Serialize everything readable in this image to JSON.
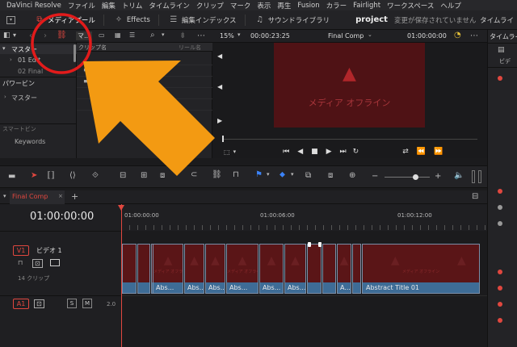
{
  "menubar": {
    "items": [
      "DaVinci Resolve",
      "ファイル",
      "編集",
      "トリム",
      "タイムライン",
      "クリップ",
      "マーク",
      "表示",
      "再生",
      "Fusion",
      "カラー",
      "Fairlight",
      "ワークスペース",
      "ヘルプ"
    ]
  },
  "toolbar": {
    "media_pool": "メディアプール",
    "effects": "Effects",
    "edit_index": "編集インデックス",
    "sound_library": "サウンドライブラリ",
    "project": "project",
    "unsaved": "変更が保存されていません",
    "timeline_label": "タイムライ"
  },
  "row2": {
    "master_btn": "マ...",
    "zoom": "15%",
    "timecode": "00:00:23:25",
    "timeline_name": "Final Comp",
    "timeline_tc": "01:00:00:00"
  },
  "sidebar": {
    "master": "マスター",
    "item1": "01 Edit",
    "item2": "02 Final",
    "powerbin": "パワービン",
    "master2": "マスター",
    "smart": "スマートビン",
    "keywords": "Keywords"
  },
  "mediapanel": {
    "col_clipname": "クリップ名",
    "col_reel": "リール名"
  },
  "viewer": {
    "offline_text": "メディア オフライン"
  },
  "rightpanel": {
    "tab_label": "ビデ"
  },
  "tabbar": {
    "tab": "Final Comp",
    "add": "+"
  },
  "timeline": {
    "timecode": "01:00:00:00",
    "ruler": [
      "01:00:00:00",
      "01:00:06:00",
      "01:00:12:00"
    ],
    "v1_badge": "V1",
    "v1_name": "ビデオ 1",
    "v1_clips": "14 クリップ",
    "a1_badge": "A1",
    "a1_s": "S",
    "a1_m": "M",
    "a1_vol": "2.0",
    "clips": [
      "",
      "",
      "",
      "Abs...",
      "Abs...",
      "Abs...",
      "Abs...",
      "Abs...",
      "Abs...",
      "",
      "",
      "A...",
      "",
      "Abstract Title 01"
    ],
    "offline_small": "メディア オフライン"
  },
  "colors": {
    "accent_red": "#e0473f",
    "clip_red": "#5a1517",
    "clip_blue": "#3e6c96",
    "annotation_orange": "#f39a12",
    "annotation_circle": "#e21b1b"
  }
}
